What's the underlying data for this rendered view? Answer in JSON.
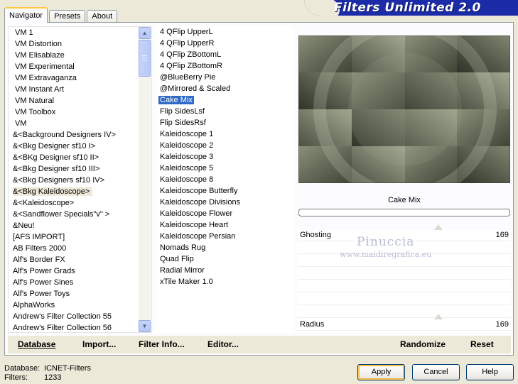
{
  "window": {
    "title": "Filters Unlimited 2.0"
  },
  "tabs": [
    {
      "label": "Navigator",
      "active": true
    },
    {
      "label": "Presets",
      "active": false
    },
    {
      "label": "About",
      "active": false
    }
  ],
  "categories": {
    "selected_index": 15,
    "items": [
      "VM 1",
      "VM Distortion",
      "VM Elisablaze",
      "VM Experimental",
      "VM Extravaganza",
      "VM Instant Art",
      "VM Natural",
      "VM Toolbox",
      "VM",
      "&<Background Designers IV>",
      "&<Bkg Designer sf10 I>",
      "&<BKg Designer sf10 II>",
      "&<Bkg Designer sf10 III>",
      "&<Bkg Designers sf10 IV>",
      "&<Bkg Kaleidoscope>",
      "&<Kaleidoscope>",
      "&<Sandflower Specials\"v\" >",
      "&Neu!",
      "[AFS IMPORT]",
      "AB Filters 2000",
      "Alf's Border FX",
      "Alf's Power Grads",
      "Alf's Power Sines",
      "Alf's Power Toys",
      "AlphaWorks",
      "Andrew's Filter Collection 55",
      "Andrew's Filter Collection 56"
    ]
  },
  "filters": {
    "selected": "Cake Mix",
    "items": [
      "4 QFlip UpperL",
      "4 QFlip UpperR",
      "4 QFlip ZBottomL",
      "4 QFlip ZBottomR",
      "@BlueBerry Pie",
      "@Mirrored & Scaled",
      "Cake Mix",
      "Flip SidesLsf",
      "Flip SidesRsf",
      "Kaleidoscope 1",
      "Kaleidoscope 2",
      "Kaleidoscope 3",
      "Kaleidoscope 5",
      "Kaleidoscope 8",
      "Kaleidoscope Butterfly",
      "Kaleidoscope Divisions",
      "Kaleidoscope Flower",
      "Kaleidoscope Heart",
      "Kaleidoscope Persian",
      "Nomads Rug",
      "Quad Flip",
      "Radial Mirror",
      "xTile Maker 1.0"
    ]
  },
  "preview": {
    "filter_name": "Cake Mix"
  },
  "params": [
    {
      "label": "Ghosting",
      "value": "169"
    },
    {
      "label": "Radius",
      "value": "169"
    }
  ],
  "watermark": {
    "line1": "Pinuccia",
    "line2": "www.maidiregrafica.eu"
  },
  "bottom_buttons": {
    "database": "Database",
    "import": "Import...",
    "filter_info": "Filter Info...",
    "editor": "Editor...",
    "randomize": "Randomize",
    "reset": "Reset"
  },
  "status": {
    "database_label": "Database:",
    "database_value": "ICNET-Filters",
    "filters_label": "Filters:",
    "filters_value": "1233"
  },
  "dialog_buttons": {
    "apply": "Apply",
    "cancel": "Cancel",
    "help": "Help"
  }
}
